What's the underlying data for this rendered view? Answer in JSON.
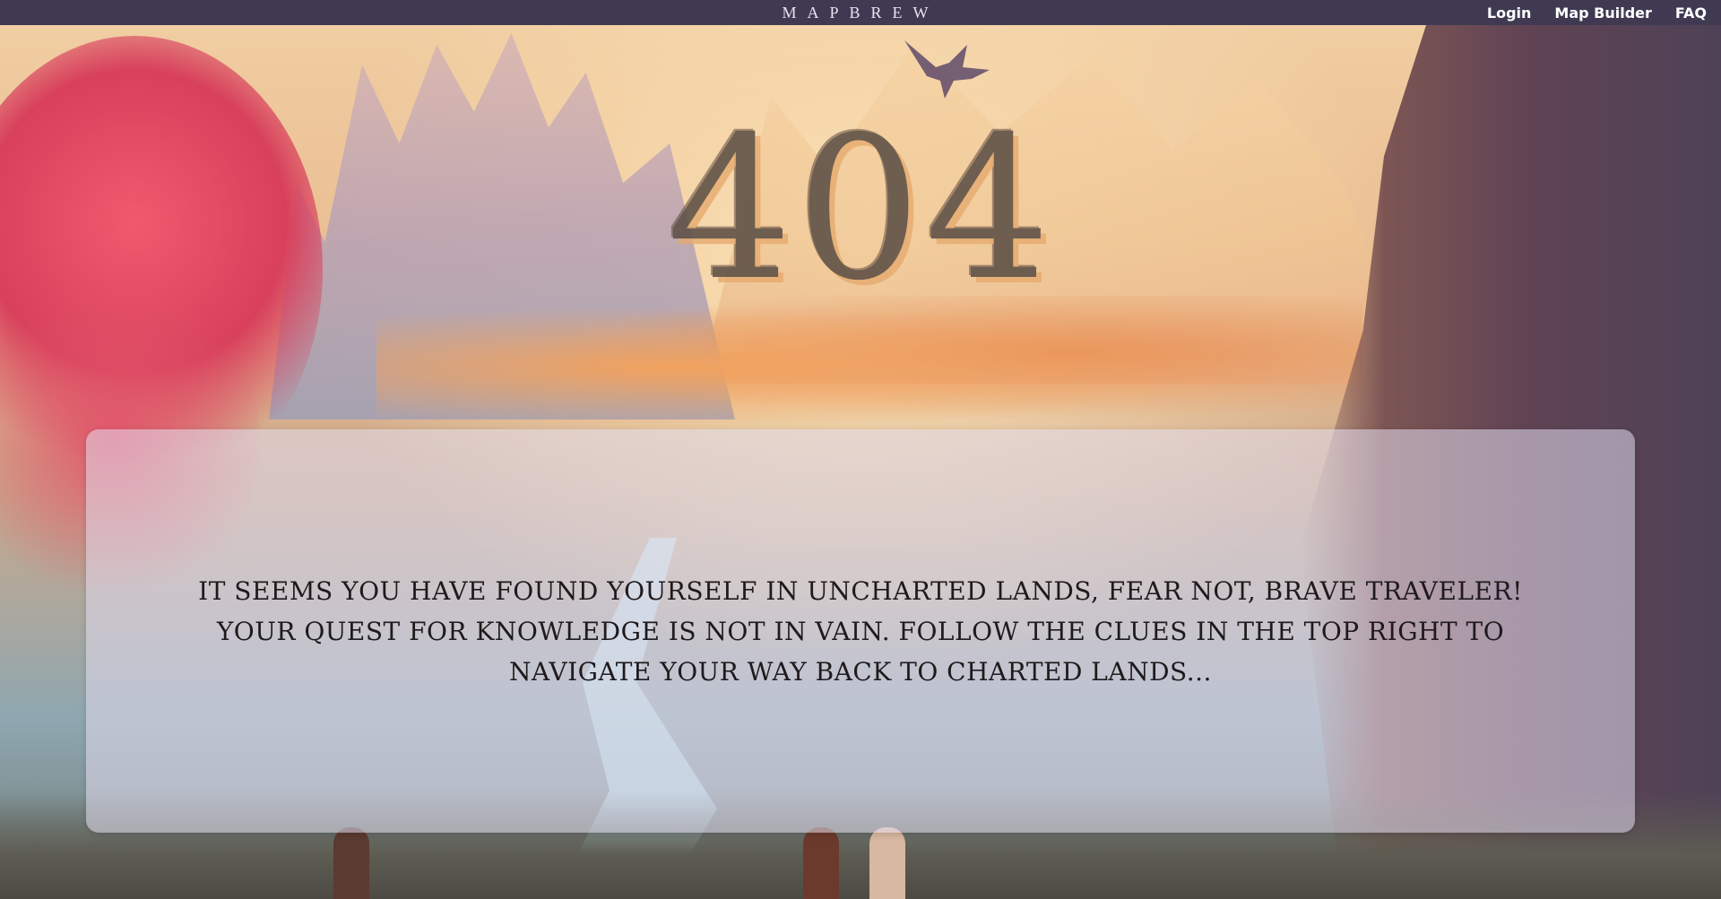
{
  "header": {
    "brand": "MAPBREW",
    "nav": {
      "login": "Login",
      "map_builder": "Map Builder",
      "faq": "FAQ"
    }
  },
  "main": {
    "error_code": "404",
    "message": "IT SEEMS YOU HAVE FOUND YOURSELF IN UNCHARTED LANDS, FEAR NOT, BRAVE TRAVELER! YOUR QUEST FOR KNOWLEDGE IS NOT IN VAIN. FOLLOW THE CLUES IN THE TOP RIGHT TO NAVIGATE YOUR WAY BACK TO CHARTED LANDS..."
  },
  "colors": {
    "header_bg": "#3f3a52",
    "error_code": "#5c4f45",
    "panel_bg": "rgba(225,220,238,0.55)",
    "message_text": "#1f1a1c"
  },
  "icons": {
    "background": "fantasy-landscape-illustration",
    "creature": "dragon-silhouette"
  }
}
